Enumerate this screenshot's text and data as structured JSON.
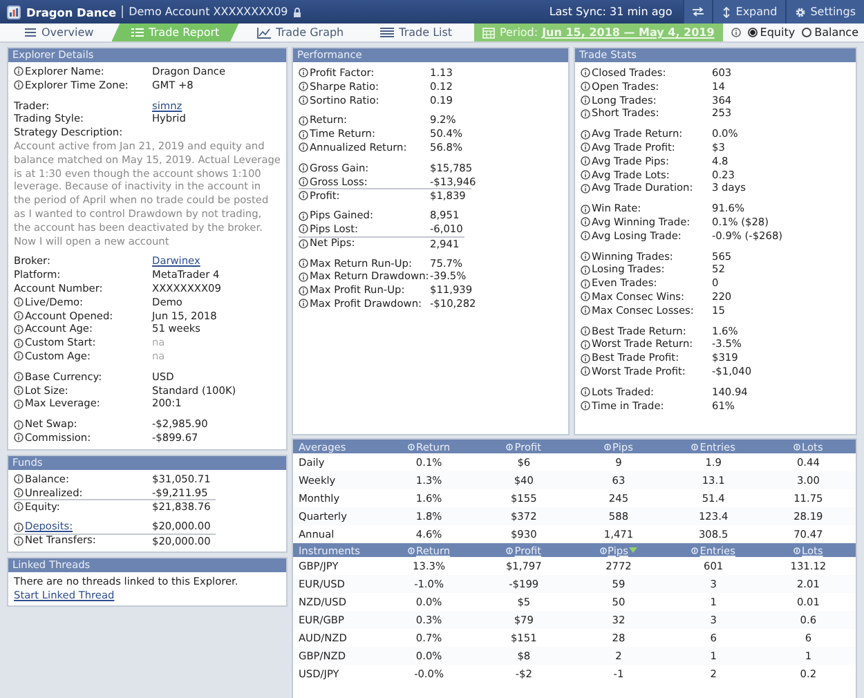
{
  "header": {
    "title": "Dragon Dance",
    "account": "Demo Account XXXXXXXX09",
    "sync": "Last Sync: 31 min ago",
    "buttons": [
      {
        "kind": "swap"
      },
      {
        "kind": "expand",
        "label": "Expand"
      },
      {
        "kind": "settings",
        "label": "Settings"
      }
    ]
  },
  "tabs": [
    {
      "label": "Overview",
      "selected": false
    },
    {
      "label": "Trade Report",
      "selected": true
    },
    {
      "label": "Trade Graph",
      "selected": false
    },
    {
      "label": "Trade List",
      "selected": false
    }
  ],
  "period": {
    "label": "Period:",
    "range": "Jun 15, 2018 — May 4, 2019"
  },
  "display_mode": [
    {
      "label": "Equity",
      "selected": true
    },
    {
      "label": "Balance",
      "selected": false
    }
  ],
  "explorer_details": {
    "title": "Explorer Details",
    "groups": [
      {
        "summed": false,
        "rows": [
          {
            "kind": "field",
            "info": true,
            "label": "Explorer Name:",
            "value": "Dragon Dance"
          },
          {
            "kind": "field",
            "info": true,
            "label": "Explorer Time Zone:",
            "value": "GMT +8"
          }
        ]
      },
      {
        "summed": false,
        "rows": [
          {
            "kind": "link",
            "info": false,
            "label": "Trader:",
            "value": "simnz"
          },
          {
            "kind": "field",
            "info": false,
            "label": "Trading Style:",
            "value": "Hybrid"
          },
          {
            "kind": "description",
            "label": "Strategy Description:",
            "value": "Account active from Jan 21, 2019 and equity and balance matched on May 15, 2019. Actual Leverage is at 1:30 even though the account shows 1:100 leverage. Because of inactivity in the account in the period of April when no trade could be posted as I wanted to control Drawdown by not trading, the account has been deactivated by the broker. Now I will open a new account"
          }
        ]
      },
      {
        "summed": false,
        "rows": [
          {
            "kind": "link",
            "info": false,
            "label": "Broker:",
            "value": "Darwinex"
          },
          {
            "kind": "field",
            "info": false,
            "label": "Platform:",
            "value": "MetaTrader 4"
          },
          {
            "kind": "field",
            "info": false,
            "label": "Account Number:",
            "value": "XXXXXXXX09"
          },
          {
            "kind": "field",
            "info": true,
            "label": "Live/Demo:",
            "value": "Demo"
          },
          {
            "kind": "field",
            "info": true,
            "label": "Account Opened:",
            "value": "Jun 15, 2018"
          },
          {
            "kind": "field",
            "info": true,
            "label": "Account Age:",
            "value": "51 weeks"
          },
          {
            "kind": "faint",
            "info": true,
            "label": "Custom Start:",
            "value": "na"
          },
          {
            "kind": "faint",
            "info": true,
            "label": "Custom Age:",
            "value": "na"
          }
        ]
      },
      {
        "summed": false,
        "rows": [
          {
            "kind": "field",
            "info": true,
            "label": "Base Currency:",
            "value": "USD"
          },
          {
            "kind": "field",
            "info": true,
            "label": "Lot Size:",
            "value": "Standard (100K)"
          },
          {
            "kind": "field",
            "info": true,
            "label": "Max Leverage:",
            "value": "200:1"
          }
        ]
      },
      {
        "summed": false,
        "rows": [
          {
            "kind": "field",
            "info": true,
            "label": "Net Swap:",
            "value": "-$2,985.90"
          },
          {
            "kind": "field",
            "info": true,
            "label": "Commission:",
            "value": "-$899.67"
          }
        ]
      }
    ]
  },
  "funds": {
    "title": "Funds",
    "groups": [
      {
        "summed": true,
        "rows": [
          {
            "kind": "field",
            "info": true,
            "label": "Balance:",
            "value": "$31,050.71"
          },
          {
            "kind": "field",
            "info": true,
            "label": "Unrealized:",
            "value": "-$9,211.95"
          },
          {
            "kind": "field",
            "info": true,
            "label": "Equity:",
            "value": "$21,838.76"
          }
        ]
      },
      {
        "summed": true,
        "rows": [
          {
            "kind": "labellink",
            "info": true,
            "label": "Deposits:",
            "value": "$20,000.00"
          },
          {
            "kind": "field",
            "info": true,
            "label": "Net Transfers:",
            "value": "$20,000.00"
          }
        ]
      }
    ]
  },
  "linked_threads": {
    "title": "Linked Threads",
    "message": "There are no threads linked to this Explorer.",
    "link": "Start Linked Thread"
  },
  "performance": {
    "title": "Performance",
    "groups": [
      {
        "summed": false,
        "rows": [
          {
            "label": "Profit Factor:",
            "value": "1.13"
          },
          {
            "label": "Sharpe Ratio:",
            "value": "0.12"
          },
          {
            "label": "Sortino Ratio:",
            "value": "0.19"
          }
        ]
      },
      {
        "summed": false,
        "rows": [
          {
            "label": "Return:",
            "value": "9.2%"
          },
          {
            "label": "Time Return:",
            "value": "50.4%"
          },
          {
            "label": "Annualized Return:",
            "value": "56.8%"
          }
        ]
      },
      {
        "summed": true,
        "rows": [
          {
            "label": "Gross Gain:",
            "value": "$15,785"
          },
          {
            "label": "Gross Loss:",
            "value": "-$13,946"
          },
          {
            "label": "Profit:",
            "value": "$1,839"
          }
        ]
      },
      {
        "summed": true,
        "rows": [
          {
            "label": "Pips Gained:",
            "value": "8,951"
          },
          {
            "label": "Pips Lost:",
            "value": "-6,010"
          },
          {
            "label": "Net Pips:",
            "value": "2,941"
          }
        ]
      },
      {
        "summed": false,
        "rows": [
          {
            "label": "Max Return Run-Up:",
            "value": "75.7%"
          },
          {
            "label": "Max Return Drawdown:",
            "value": "-39.5%"
          },
          {
            "label": "Max Profit Run-Up:",
            "value": "$11,939"
          },
          {
            "label": "Max Profit Drawdown:",
            "value": "-$10,282"
          }
        ]
      }
    ]
  },
  "trade_stats": {
    "title": "Trade Stats",
    "groups": [
      {
        "summed": false,
        "rows": [
          {
            "label": "Closed Trades:",
            "value": "603"
          },
          {
            "label": "Open Trades:",
            "value": "14"
          },
          {
            "label": "Long Trades:",
            "value": "364"
          },
          {
            "label": "Short Trades:",
            "value": "253"
          }
        ]
      },
      {
        "summed": false,
        "rows": [
          {
            "label": "Avg Trade Return:",
            "value": "0.0%"
          },
          {
            "label": "Avg Trade Profit:",
            "value": "$3"
          },
          {
            "label": "Avg Trade Pips:",
            "value": "4.8"
          },
          {
            "label": "Avg Trade Lots:",
            "value": "0.23"
          },
          {
            "label": "Avg Trade Duration:",
            "value": "3 days"
          }
        ]
      },
      {
        "summed": false,
        "rows": [
          {
            "label": "Win Rate:",
            "value": "91.6%"
          },
          {
            "label": "Avg Winning Trade:",
            "value": "0.1% ($28)"
          },
          {
            "label": "Avg Losing Trade:",
            "value": "-0.9% (-$268)"
          }
        ]
      },
      {
        "summed": false,
        "rows": [
          {
            "label": "Winning Trades:",
            "value": "565"
          },
          {
            "label": "Losing Trades:",
            "value": "52"
          },
          {
            "label": "Even Trades:",
            "value": "0"
          },
          {
            "label": "Max Consec Wins:",
            "value": "220"
          },
          {
            "label": "Max Consec Losses:",
            "value": "15"
          }
        ]
      },
      {
        "summed": false,
        "rows": [
          {
            "label": "Best Trade Return:",
            "value": "1.6%"
          },
          {
            "label": "Worst Trade Return:",
            "value": "-3.5%"
          },
          {
            "label": "Best Trade Profit:",
            "value": "$319"
          },
          {
            "label": "Worst Trade Profit:",
            "value": "-$1,040"
          }
        ]
      },
      {
        "summed": false,
        "rows": [
          {
            "label": "Lots Traded:",
            "value": "140.94"
          },
          {
            "label": "Time in Trade:",
            "value": "61%"
          }
        ]
      }
    ]
  },
  "tables": [
    {
      "column_links": false,
      "title": "Averages",
      "columns": [
        {
          "label": "Return",
          "sorted": false
        },
        {
          "label": "Profit",
          "sorted": false
        },
        {
          "label": "Pips",
          "sorted": false
        },
        {
          "label": "Entries",
          "sorted": false
        },
        {
          "label": "Lots",
          "sorted": false
        }
      ],
      "rows": [
        {
          "label": "Daily",
          "cells": [
            "0.1%",
            "$6",
            "9",
            "1.9",
            "0.44"
          ]
        },
        {
          "label": "Weekly",
          "cells": [
            "1.3%",
            "$40",
            "63",
            "13.1",
            "3.00"
          ]
        },
        {
          "label": "Monthly",
          "cells": [
            "1.6%",
            "$155",
            "245",
            "51.4",
            "11.75"
          ]
        },
        {
          "label": "Quarterly",
          "cells": [
            "1.8%",
            "$372",
            "588",
            "123.4",
            "28.19"
          ]
        },
        {
          "label": "Annual",
          "cells": [
            "4.6%",
            "$930",
            "1,471",
            "308.5",
            "70.47"
          ]
        }
      ]
    },
    {
      "column_links": true,
      "title": "Instruments",
      "columns": [
        {
          "label": "Return",
          "sorted": false
        },
        {
          "label": "Profit",
          "sorted": false
        },
        {
          "label": "Pips",
          "sorted": true
        },
        {
          "label": "Entries",
          "sorted": false
        },
        {
          "label": "Lots",
          "sorted": false
        }
      ],
      "rows": [
        {
          "label": "GBP/JPY",
          "cells": [
            "13.3%",
            "$1,797",
            "2772",
            "601",
            "131.12"
          ]
        },
        {
          "label": "EUR/USD",
          "cells": [
            "-1.0%",
            "-$199",
            "59",
            "3",
            "2.01"
          ]
        },
        {
          "label": "NZD/USD",
          "cells": [
            "0.0%",
            "$5",
            "50",
            "1",
            "0.01"
          ]
        },
        {
          "label": "EUR/GBP",
          "cells": [
            "0.3%",
            "$79",
            "32",
            "3",
            "0.6"
          ]
        },
        {
          "label": "AUD/NZD",
          "cells": [
            "0.7%",
            "$151",
            "28",
            "6",
            "6"
          ]
        },
        {
          "label": "GBP/NZD",
          "cells": [
            "0.0%",
            "$8",
            "2",
            "1",
            "1"
          ]
        },
        {
          "label": "USD/JPY",
          "cells": [
            "-0.0%",
            "-$2",
            "-1",
            "2",
            "0.2"
          ]
        }
      ]
    }
  ]
}
